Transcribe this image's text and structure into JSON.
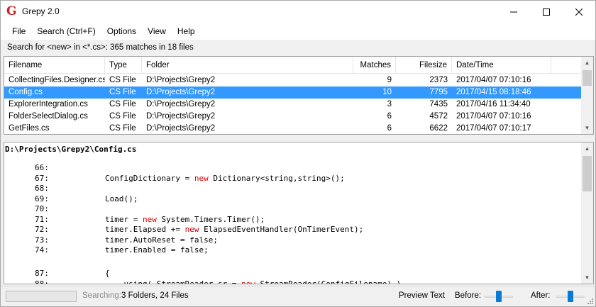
{
  "window": {
    "title": "Grepy 2.0",
    "app_icon_letter": "G"
  },
  "menu": {
    "items": [
      "File",
      "Search (Ctrl+F)",
      "Options",
      "View",
      "Help"
    ]
  },
  "search_info": "Search for <new> in <*.cs>: 365 matches in 18 files",
  "results": {
    "columns": [
      "Filename",
      "Type",
      "Folder",
      "Matches",
      "Filesize",
      "Date/Time"
    ],
    "rows": [
      {
        "filename": "CollectingFiles.Designer.cs",
        "type": "CS File",
        "folder": "D:\\Projects\\Grepy2",
        "matches": "9",
        "filesize": "2373",
        "datetime": "2017/04/07 07:10:16",
        "selected": false
      },
      {
        "filename": "Config.cs",
        "type": "CS File",
        "folder": "D:\\Projects\\Grepy2",
        "matches": "10",
        "filesize": "7795",
        "datetime": "2017/04/15 08:18:46",
        "selected": true
      },
      {
        "filename": "ExplorerIntegration.cs",
        "type": "CS File",
        "folder": "D:\\Projects\\Grepy2",
        "matches": "3",
        "filesize": "7435",
        "datetime": "2017/04/16 11:34:40",
        "selected": false
      },
      {
        "filename": "FolderSelectDialog.cs",
        "type": "CS File",
        "folder": "D:\\Projects\\Grepy2",
        "matches": "6",
        "filesize": "4572",
        "datetime": "2017/04/07 07:10:16",
        "selected": false
      },
      {
        "filename": "GetFiles.cs",
        "type": "CS File",
        "folder": "D:\\Projects\\Grepy2",
        "matches": "6",
        "filesize": "6622",
        "datetime": "2017/04/07 07:10:17",
        "selected": false
      }
    ]
  },
  "preview": {
    "path": "D:\\Projects\\Grepy2\\Config.cs",
    "lines": [
      {
        "num": "66:",
        "segments": []
      },
      {
        "num": "67:",
        "segments": [
          {
            "t": "ConfigDictionary = "
          },
          {
            "t": "new",
            "kw": true
          },
          {
            "t": " Dictionary<string,string>();"
          }
        ]
      },
      {
        "num": "68:",
        "segments": []
      },
      {
        "num": "69:",
        "segments": [
          {
            "t": "Load();"
          }
        ]
      },
      {
        "num": "70:",
        "segments": []
      },
      {
        "num": "71:",
        "segments": [
          {
            "t": "timer = "
          },
          {
            "t": "new",
            "kw": true
          },
          {
            "t": " System.Timers.Timer();"
          }
        ]
      },
      {
        "num": "72:",
        "segments": [
          {
            "t": "timer.Elapsed += "
          },
          {
            "t": "new",
            "kw": true
          },
          {
            "t": " ElapsedEventHandler(OnTimerEvent);"
          }
        ]
      },
      {
        "num": "73:",
        "segments": [
          {
            "t": "timer.AutoReset = false;"
          }
        ]
      },
      {
        "num": "74:",
        "segments": [
          {
            "t": "timer.Enabled = false;"
          }
        ]
      },
      {
        "num": "",
        "segments": []
      },
      {
        "num": "87:",
        "segments": [
          {
            "t": "{"
          }
        ]
      },
      {
        "num": "88:",
        "segments": [
          {
            "t": "    using( StreamReader sr = "
          },
          {
            "t": "new",
            "kw": true
          },
          {
            "t": " StreamReader(ConfigFilename) )"
          }
        ]
      }
    ],
    "keyword_color": "#d00000"
  },
  "status": {
    "searching_label": "Searching:",
    "searching_value": "3 Folders,  24 Files",
    "preview_text_label": "Preview Text",
    "before_label": "Before:",
    "after_label": "After:"
  },
  "colors": {
    "selection": "#3399ff",
    "slider_knob": "#0a7ad4",
    "app_icon": "#cc1f1f"
  }
}
